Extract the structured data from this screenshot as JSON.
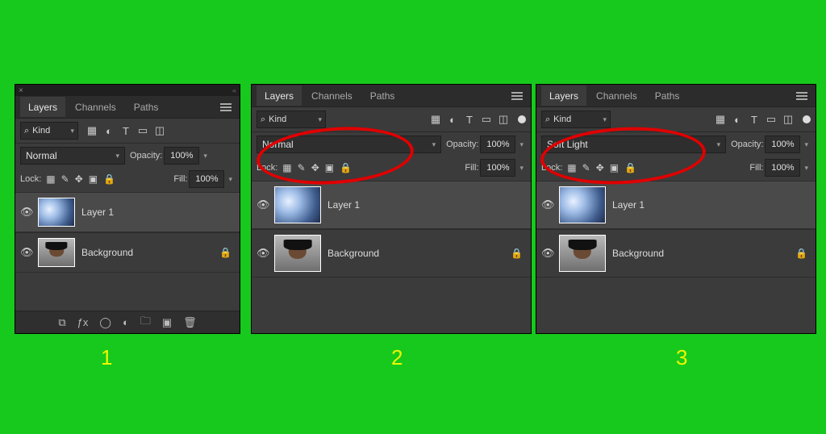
{
  "bg_color": "#17c91c",
  "annotation": {
    "labels": [
      "1",
      "2",
      "3"
    ],
    "ellipse_color": "#e00000"
  },
  "panels": [
    {
      "id": 1,
      "tabs": {
        "layers": "Layers",
        "channels": "Channels",
        "paths": "Paths",
        "active": "layers"
      },
      "filter": {
        "kind_label": "Kind"
      },
      "blend": {
        "mode": "Normal",
        "opacity_label": "Opacity:",
        "opacity_value": "100%"
      },
      "lock": {
        "label": "Lock:",
        "fill_label": "Fill:",
        "fill_value": "100%"
      },
      "layers": [
        {
          "name": "Layer 1",
          "thumb": "tex",
          "selected": true,
          "locked": false
        },
        {
          "name": "Background",
          "thumb": "portrait",
          "selected": false,
          "locked": true
        }
      ]
    },
    {
      "id": 2,
      "tabs": {
        "layers": "Layers",
        "channels": "Channels",
        "paths": "Paths",
        "active": "layers"
      },
      "filter": {
        "kind_label": "Kind"
      },
      "blend": {
        "mode": "Normal",
        "opacity_label": "Opacity:",
        "opacity_value": "100%"
      },
      "lock": {
        "label": "Lock:",
        "fill_label": "Fill:",
        "fill_value": "100%"
      },
      "layers": [
        {
          "name": "Layer 1",
          "thumb": "tex",
          "selected": true,
          "locked": false
        },
        {
          "name": "Background",
          "thumb": "portrait",
          "selected": false,
          "locked": true
        }
      ],
      "circled": true
    },
    {
      "id": 3,
      "tabs": {
        "layers": "Layers",
        "channels": "Channels",
        "paths": "Paths",
        "active": "layers"
      },
      "filter": {
        "kind_label": "Kind"
      },
      "blend": {
        "mode": "Soft Light",
        "opacity_label": "Opacity:",
        "opacity_value": "100%"
      },
      "lock": {
        "label": "Lock:",
        "fill_label": "Fill:",
        "fill_value": "100%"
      },
      "layers": [
        {
          "name": "Layer 1",
          "thumb": "tex",
          "selected": true,
          "locked": false
        },
        {
          "name": "Background",
          "thumb": "portrait",
          "selected": false,
          "locked": true
        }
      ],
      "circled": true
    }
  ]
}
